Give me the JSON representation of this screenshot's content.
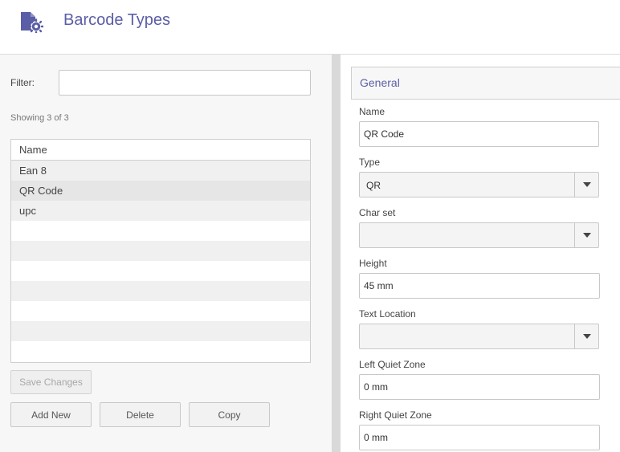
{
  "header": {
    "title": "Barcode Types",
    "icon": "barcode-settings-icon",
    "accent_color": "#5b5ea6"
  },
  "list_panel": {
    "filter_label": "Filter:",
    "filter_value": "",
    "showing_text": "Showing 3 of 3",
    "column_header": "Name",
    "rows": [
      "Ean 8",
      "QR Code",
      "upc"
    ],
    "selected_row": "QR Code",
    "buttons": {
      "save": "Save Changes",
      "add": "Add New",
      "delete": "Delete",
      "copy": "Copy"
    }
  },
  "details_panel": {
    "section_title": "General",
    "fields": {
      "name": {
        "label": "Name",
        "value": "QR Code"
      },
      "type": {
        "label": "Type",
        "value": "QR"
      },
      "charset": {
        "label": "Char set",
        "value": ""
      },
      "height": {
        "label": "Height",
        "value": "45 mm"
      },
      "text_location": {
        "label": "Text Location",
        "value": ""
      },
      "left_quiet_zone": {
        "label": "Left Quiet Zone",
        "value": "0 mm"
      },
      "right_quiet_zone": {
        "label": "Right Quiet Zone",
        "value": "0 mm"
      }
    }
  }
}
